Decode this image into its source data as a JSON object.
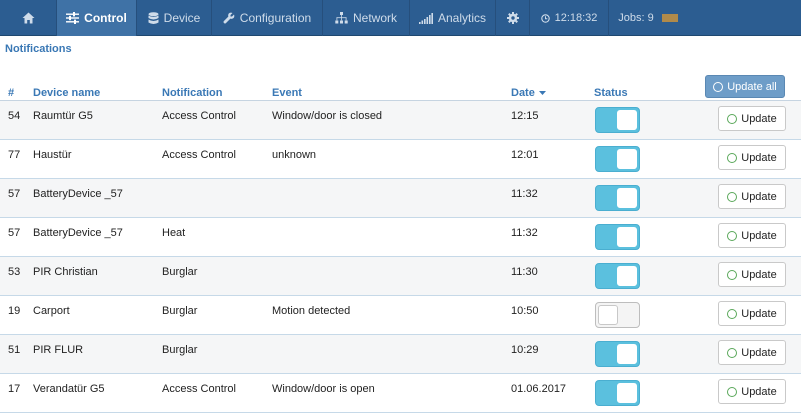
{
  "nav": {
    "control_label": "Control",
    "device_label": "Device",
    "configuration_label": "Configuration",
    "network_label": "Network",
    "analytics_label": "Analytics",
    "time": "12:18:32",
    "jobs_label": "Jobs: 9"
  },
  "page": {
    "title": "Notifications"
  },
  "table": {
    "headers": {
      "id": "#",
      "device_name": "Device name",
      "notification": "Notification",
      "event": "Event",
      "date": "Date",
      "status": "Status"
    },
    "update_all_label": "Update all",
    "update_label": "Update",
    "rows": [
      {
        "id": "54",
        "device": "Raumtür G5",
        "notification": "Access Control",
        "event": "Window/door is closed",
        "date": "12:15",
        "status": "on"
      },
      {
        "id": "77",
        "device": "Haustür",
        "notification": "Access Control",
        "event": "unknown",
        "date": "12:01",
        "status": "on"
      },
      {
        "id": "57",
        "device": "BatteryDevice _57",
        "notification": "",
        "event": "",
        "date": "11:32",
        "status": "on"
      },
      {
        "id": "57",
        "device": "BatteryDevice _57",
        "notification": "Heat",
        "event": "",
        "date": "11:32",
        "status": "on"
      },
      {
        "id": "53",
        "device": "PIR Christian",
        "notification": "Burglar",
        "event": "",
        "date": "11:30",
        "status": "on"
      },
      {
        "id": "19",
        "device": "Carport",
        "notification": "Burglar",
        "event": "Motion detected",
        "date": "10:50",
        "status": "off"
      },
      {
        "id": "51",
        "device": "PIR FLUR",
        "notification": "Burglar",
        "event": "",
        "date": "10:29",
        "status": "on"
      },
      {
        "id": "17",
        "device": "Verandatür G5",
        "notification": "Access Control",
        "event": "Window/door is open",
        "date": "01.06.2017",
        "status": "on"
      }
    ]
  },
  "colors": {
    "navbar": "#2c5d91",
    "navbar_active": "#3f72a6",
    "header_text": "#3a78b5",
    "toggle_on": "#5bc0de",
    "update_ring": "#5aa85a"
  }
}
